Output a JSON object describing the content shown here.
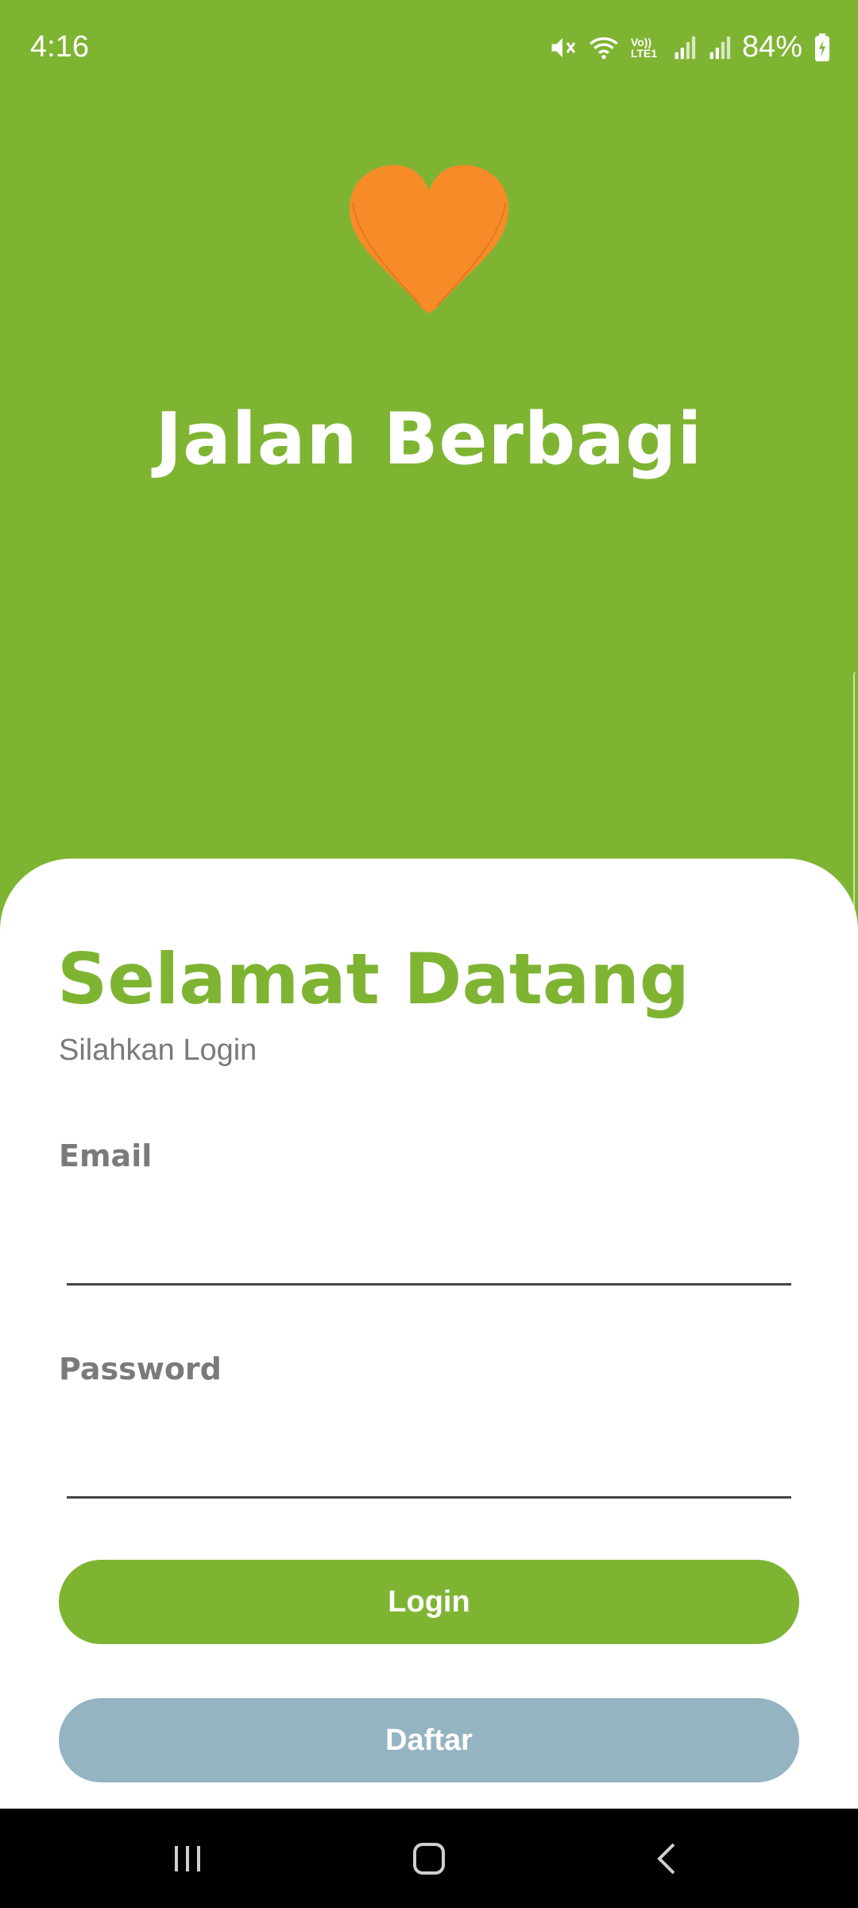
{
  "status_bar": {
    "time": "4:16",
    "battery": "84%",
    "icons": [
      "mute-icon",
      "wifi-icon",
      "volte-icon",
      "signal-icon",
      "signal-icon",
      "battery-charging-icon"
    ],
    "volte_label": "Vo)) LTE1"
  },
  "hero": {
    "logo_icon": "heart-icon",
    "app_title": "Jalan Berbagi"
  },
  "login_card": {
    "title": "Selamat Datang",
    "subtitle": "Silahkan Login",
    "email_label": "Email",
    "email_value": "",
    "password_label": "Password",
    "password_value": "",
    "login_button": "Login",
    "register_button": "Daftar"
  },
  "nav_bar": {
    "icons": [
      "recent-apps-icon",
      "home-icon",
      "back-icon"
    ]
  },
  "colors": {
    "brand_green": "#7fb433",
    "heart_orange": "#f68b28",
    "secondary_button": "#94b4c2",
    "label_gray": "#7a7a7a"
  }
}
